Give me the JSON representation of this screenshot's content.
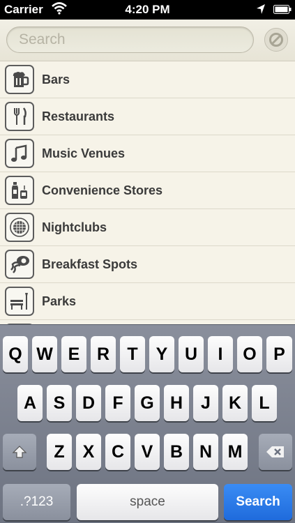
{
  "status_bar": {
    "carrier": "Carrier",
    "time": "4:20 PM"
  },
  "search": {
    "placeholder": "Search"
  },
  "categories": [
    {
      "label": "Bars",
      "icon": "beer-mug-icon"
    },
    {
      "label": "Restaurants",
      "icon": "fork-knife-icon"
    },
    {
      "label": "Music Venues",
      "icon": "music-note-icon"
    },
    {
      "label": "Convenience Stores",
      "icon": "bottles-icon"
    },
    {
      "label": "Nightclubs",
      "icon": "disco-ball-icon"
    },
    {
      "label": "Breakfast Spots",
      "icon": "bacon-egg-icon"
    },
    {
      "label": "Parks",
      "icon": "park-bench-icon"
    }
  ],
  "keyboard": {
    "row1": [
      "Q",
      "W",
      "E",
      "R",
      "T",
      "Y",
      "U",
      "I",
      "O",
      "P"
    ],
    "row2": [
      "A",
      "S",
      "D",
      "F",
      "G",
      "H",
      "J",
      "K",
      "L"
    ],
    "row3": [
      "Z",
      "X",
      "C",
      "V",
      "B",
      "N",
      "M"
    ],
    "numbers_label": ".?123",
    "space_label": "space",
    "search_label": "Search"
  },
  "colors": {
    "background": "#f6f3e8",
    "search_key": "#2a7be8",
    "icon_stroke": "#5c5c5c"
  }
}
